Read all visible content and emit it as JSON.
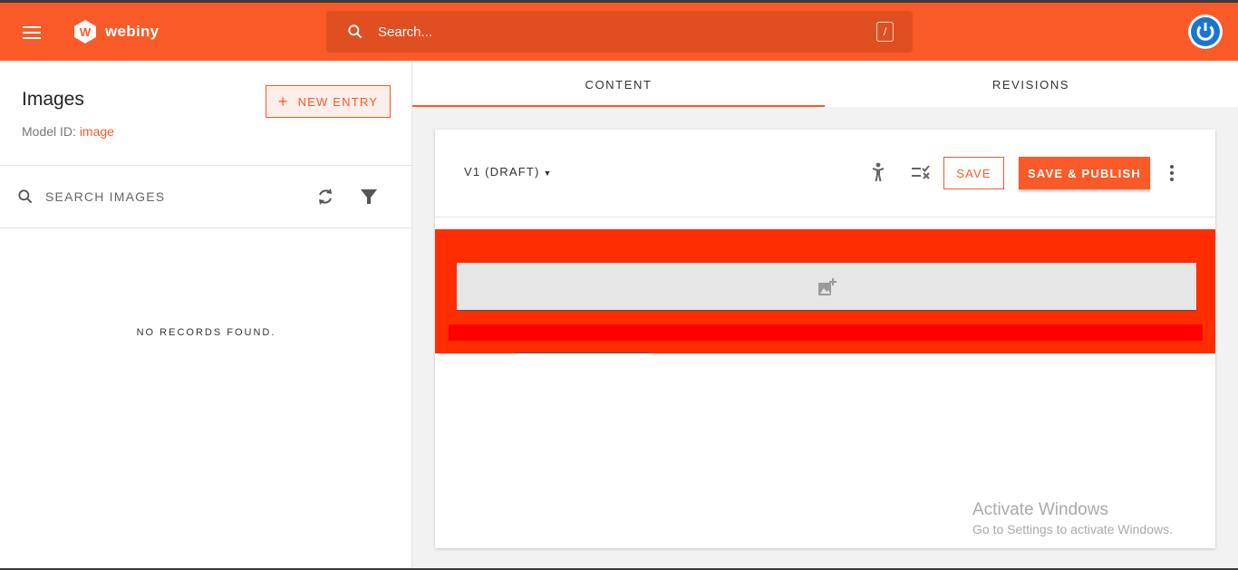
{
  "header": {
    "brand": "webiny",
    "search_placeholder": "Search...",
    "search_shortcut": "/",
    "colors": {
      "brand": "#fa5a28",
      "search_bg": "#e04f22",
      "avatar": "#1a75cf"
    }
  },
  "sidebar": {
    "title": "Images",
    "model_label": "Model ID:",
    "model_value": "image",
    "new_entry_label": "NEW ENTRY",
    "search_placeholder": "SEARCH IMAGES",
    "empty_text": "NO RECORDS FOUND."
  },
  "tabs": [
    {
      "label": "CONTENT",
      "active": true
    },
    {
      "label": "REVISIONS",
      "active": false
    }
  ],
  "editor": {
    "version_label": "V1 (DRAFT)",
    "save_label": "SAVE",
    "publish_label": "SAVE & PUBLISH"
  },
  "watermark": {
    "line1": "Activate Windows",
    "line2": "Go to Settings to activate Windows."
  }
}
